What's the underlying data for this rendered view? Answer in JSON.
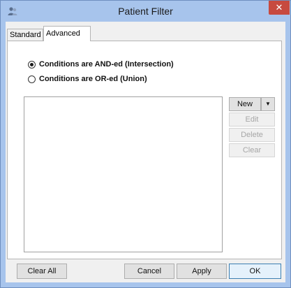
{
  "window": {
    "title": "Patient Filter",
    "close_glyph": "✕",
    "app_icon": "users-icon"
  },
  "tabs": [
    {
      "label": "Standard",
      "active": false
    },
    {
      "label": "Advanced",
      "active": true
    }
  ],
  "logic": {
    "and_label": "Conditions are AND-ed (Intersection)",
    "or_label": "Conditions are OR-ed (Union)",
    "selected": "and"
  },
  "side_buttons": {
    "new_label": "New",
    "new_dropdown": "chevron-down-icon",
    "edit_label": "Edit",
    "delete_label": "Delete",
    "clear_label": "Clear"
  },
  "footer": {
    "clear_all_label": "Clear All",
    "cancel_label": "Cancel",
    "apply_label": "Apply",
    "ok_label": "OK"
  },
  "colors": {
    "titlebar": "#a7c4ec",
    "close": "#c74a3f"
  }
}
